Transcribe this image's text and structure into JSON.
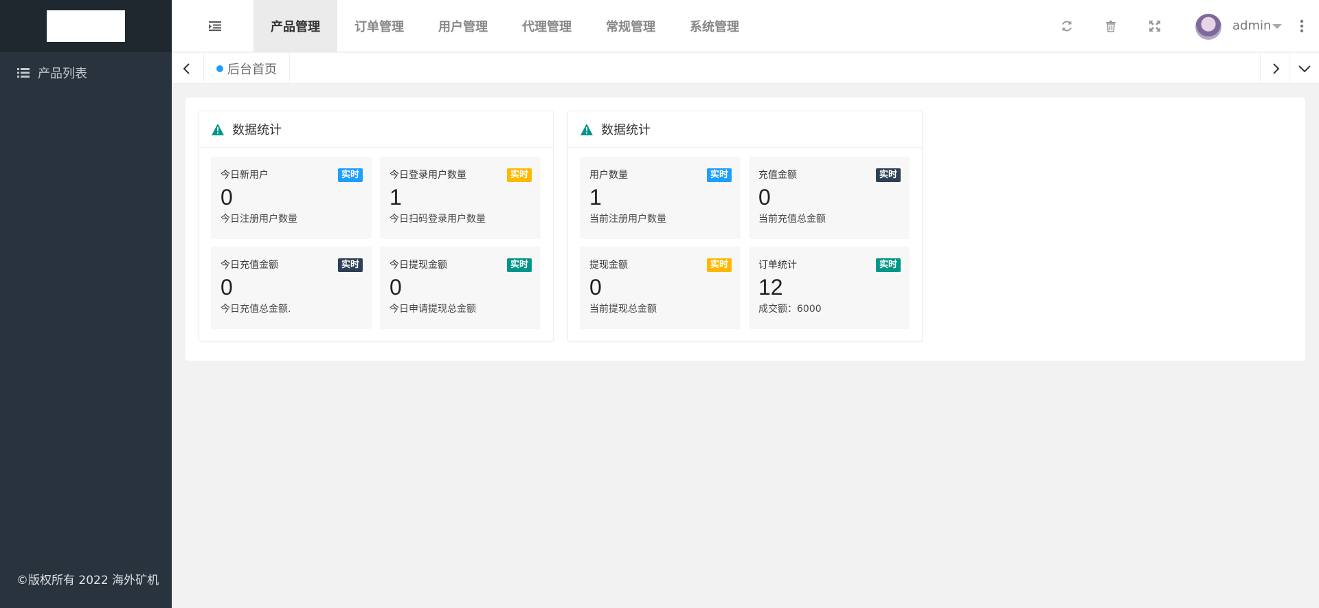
{
  "sidebar": {
    "items": [
      {
        "label": "产品列表",
        "icon": "list-icon"
      }
    ],
    "copyright": "©版权所有 2022 海外矿机"
  },
  "header": {
    "nav": [
      "产品管理",
      "订单管理",
      "用户管理",
      "代理管理",
      "常规管理",
      "系统管理"
    ],
    "active_nav": "产品管理",
    "username": "admin",
    "icons": [
      "refresh-icon",
      "trash-icon",
      "fullscreen-icon",
      "more-icon"
    ]
  },
  "tabs": {
    "home_label": "后台首页"
  },
  "panels": [
    {
      "title": "数据统计",
      "cards": [
        {
          "title": "今日新用户",
          "badge": "实时",
          "badge_color": "#1e9fff",
          "value": "0",
          "desc": "今日注册用户数量"
        },
        {
          "title": "今日登录用户数量",
          "badge": "实时",
          "badge_color": "#ffb800",
          "value": "1",
          "desc": "今日扫码登录用户数量"
        },
        {
          "title": "今日充值金额",
          "badge": "实时",
          "badge_color": "#2f4056",
          "value": "0",
          "desc": "今日充值总金额."
        },
        {
          "title": "今日提现金额",
          "badge": "实时",
          "badge_color": "#009688",
          "value": "0",
          "desc": "今日申请提现总金额"
        }
      ]
    },
    {
      "title": "数据统计",
      "cards": [
        {
          "title": "用户数量",
          "badge": "实时",
          "badge_color": "#1e9fff",
          "value": "1",
          "desc": "当前注册用户数量"
        },
        {
          "title": "充值金额",
          "badge": "实时",
          "badge_color": "#2f4056",
          "value": "0",
          "desc": "当前充值总金额"
        },
        {
          "title": "提现金额",
          "badge": "实时",
          "badge_color": "#ffb800",
          "value": "0",
          "desc": "当前提现总金额"
        },
        {
          "title": "订单统计",
          "badge": "实时",
          "badge_color": "#009688",
          "value": "12",
          "desc": "成交额：6000"
        }
      ]
    }
  ]
}
